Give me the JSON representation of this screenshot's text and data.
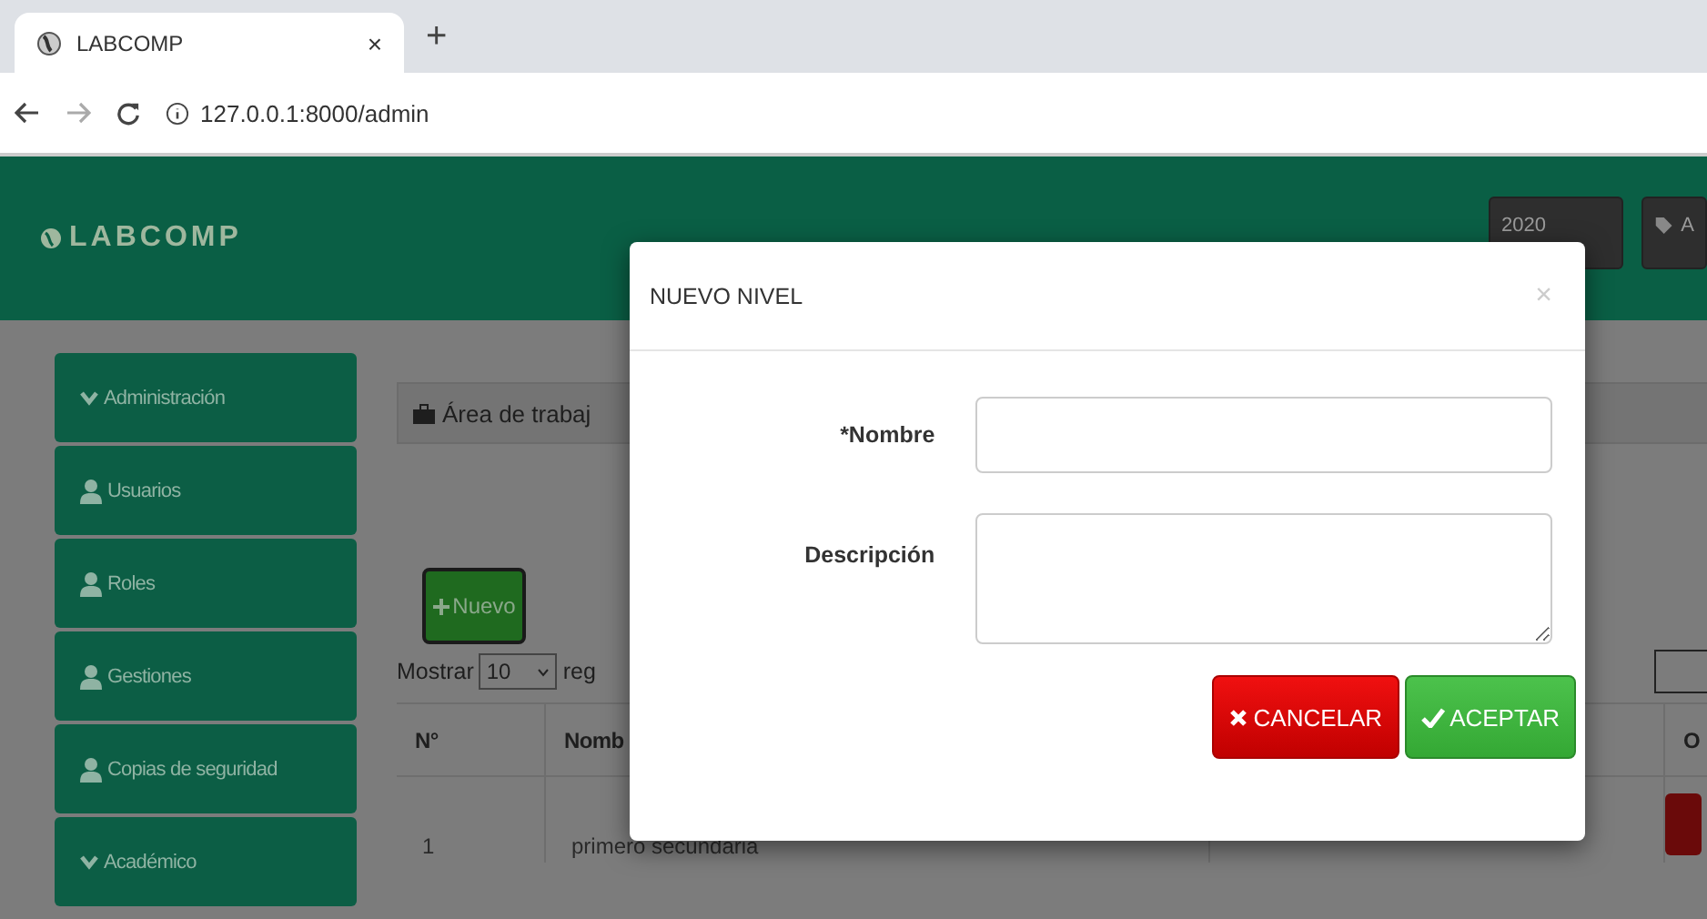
{
  "browser": {
    "tab_title": "LABCOMP",
    "tab_close": "×",
    "new_tab": "+",
    "url": "127.0.0.1:8000/admin"
  },
  "header": {
    "brand": "LABCOMP",
    "buttons": [
      {
        "label": "2020",
        "kind": "year"
      },
      {
        "label": "A",
        "kind": "tag"
      }
    ]
  },
  "sidebar": {
    "items": [
      {
        "label": "Administración",
        "kind": "section"
      },
      {
        "label": "Usuarios",
        "kind": "link"
      },
      {
        "label": "Roles",
        "kind": "link"
      },
      {
        "label": "Gestiones",
        "kind": "link"
      },
      {
        "label": "Copias de seguridad",
        "kind": "link"
      },
      {
        "label": "Académico",
        "kind": "section"
      }
    ]
  },
  "panel": {
    "title": "Área de trabaj",
    "new_button": "Nuevo",
    "length_label": "Mostrar",
    "length_value": "10",
    "length_suffix": "reg",
    "table": {
      "columns": [
        "N°",
        "Nomb",
        "O"
      ],
      "rows": [
        {
          "cells": [
            "1",
            "primero secundaria"
          ]
        }
      ]
    }
  },
  "modal": {
    "title": "NUEVO NIVEL",
    "close": "×",
    "fields": [
      {
        "label": "*Nombre",
        "kind": "input"
      },
      {
        "label": "Descripción",
        "kind": "textarea"
      }
    ],
    "buttons": [
      {
        "label": "CANCELAR",
        "kind": "cancel"
      },
      {
        "label": "ACEPTAR",
        "kind": "accept"
      }
    ]
  }
}
